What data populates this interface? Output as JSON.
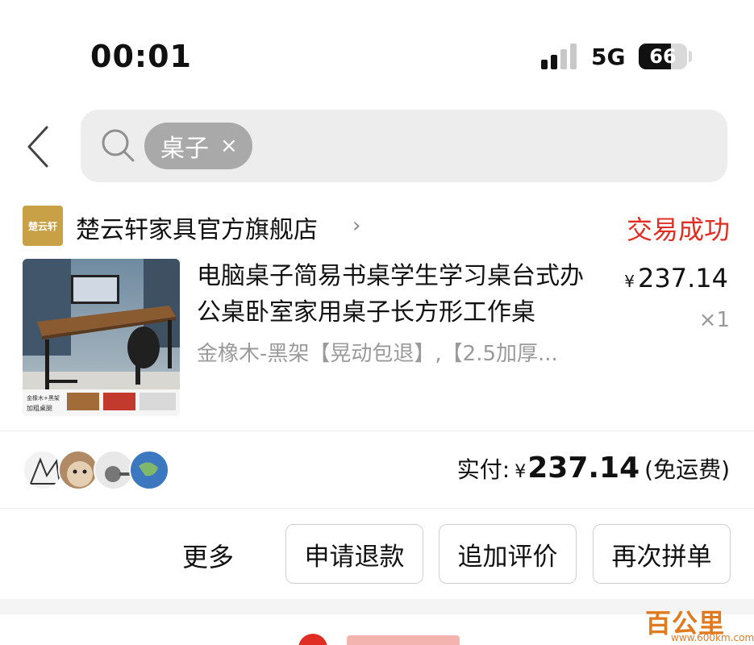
{
  "status_bar": {
    "time": "00:01",
    "network": "5G",
    "battery": "66",
    "battery_level": 0.66
  },
  "search": {
    "chip_text": "桌子",
    "chip_close": "×"
  },
  "icons": {
    "back": "chevron-left-icon",
    "search": "search-icon",
    "shop_arrow": "chevron-right-icon"
  },
  "order": {
    "shop_logo_text": "楚云轩",
    "shop_name": "楚云轩家具官方旗舰店",
    "shop_arrow": "›",
    "status": "交易成功",
    "product": {
      "title": "电脑桌子简易书桌学生学习桌台式办公桌卧室家用桌子长方形工作桌",
      "spec": "金橡木-黑架【晃动包退】,【2.5加厚...",
      "currency": "¥",
      "price": "237.14",
      "quantity": "×1"
    },
    "paid_label": "实付:",
    "paid_currency": "¥",
    "paid_amount": "237.14",
    "shipping_note": "(免运费)"
  },
  "actions": {
    "more": "更多",
    "refund": "申请退款",
    "add_review": "追加评价",
    "regroup": "再次拼单"
  },
  "watermark": {
    "title": "百公里",
    "url": "www.600km.com"
  },
  "colors": {
    "accent_red": "#e02e24",
    "chip_gray": "#a9a9a9",
    "search_bg": "#ededed",
    "muted_text": "#9a9a9a"
  }
}
